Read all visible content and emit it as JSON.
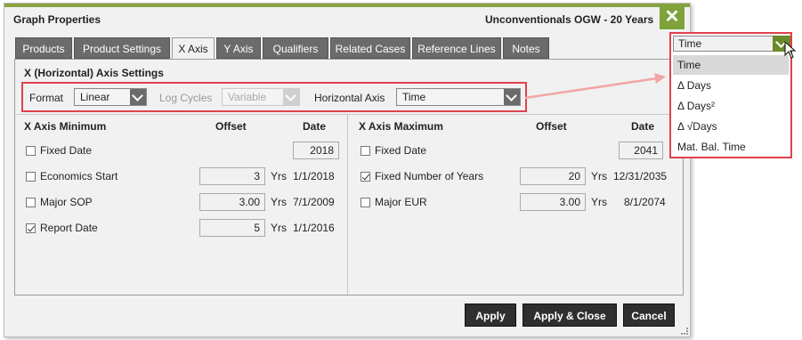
{
  "dialog": {
    "title": "Graph Properties",
    "subtitle": "Unconventionals OGW - 20 Years",
    "close_glyph": "✕"
  },
  "tabs": [
    {
      "label": "Products"
    },
    {
      "label": "Product Settings"
    },
    {
      "label": "X Axis"
    },
    {
      "label": "Y Axis"
    },
    {
      "label": "Qualifiers"
    },
    {
      "label": "Related Cases"
    },
    {
      "label": "Reference Lines"
    },
    {
      "label": "Notes"
    }
  ],
  "active_tab": "X Axis",
  "axis_settings": {
    "heading": "X (Horizontal) Axis Settings",
    "format_label": "Format",
    "format_value": "Linear",
    "log_cycles_label": "Log Cycles",
    "log_cycles_value": "Variable",
    "horizontal_axis_label": "Horizontal Axis",
    "horizontal_axis_value": "Time"
  },
  "minimum": {
    "heading": "X Axis Minimum",
    "offset_header": "Offset",
    "date_header": "Date",
    "rows": [
      {
        "label": "Fixed Date",
        "checked": false,
        "offset": "",
        "unit": "",
        "date": "2018"
      },
      {
        "label": "Economics Start",
        "checked": false,
        "offset": "3",
        "unit": "Yrs",
        "date": "1/1/2018"
      },
      {
        "label": "Major SOP",
        "checked": false,
        "offset": "3.00",
        "unit": "Yrs",
        "date": "7/1/2009"
      },
      {
        "label": "Report Date",
        "checked": true,
        "offset": "5",
        "unit": "Yrs",
        "date": "1/1/2016"
      }
    ]
  },
  "maximum": {
    "heading": "X Axis Maximum",
    "offset_header": "Offset",
    "date_header": "Date",
    "rows": [
      {
        "label": "Fixed Date",
        "checked": false,
        "offset": "",
        "unit": "",
        "date": "2041"
      },
      {
        "label": "Fixed Number of Years",
        "checked": true,
        "offset": "20",
        "unit": "Yrs",
        "date": "12/31/2035"
      },
      {
        "label": "Major EUR",
        "checked": false,
        "offset": "3.00",
        "unit": "Yrs",
        "date": "8/1/2074"
      }
    ]
  },
  "buttons": {
    "apply": "Apply",
    "apply_close": "Apply & Close",
    "cancel": "Cancel"
  },
  "dropdown": {
    "header_value": "Time",
    "options": [
      "Time",
      "Δ Days",
      "Δ Days²",
      "Δ √Days",
      "Mat. Bal. Time"
    ],
    "selected": "Time"
  },
  "colors": {
    "accent_green": "#7ea33a",
    "highlight_red": "#e0414c",
    "tab_dark": "#6b6b6b",
    "button_dark": "#2f2f2f"
  }
}
